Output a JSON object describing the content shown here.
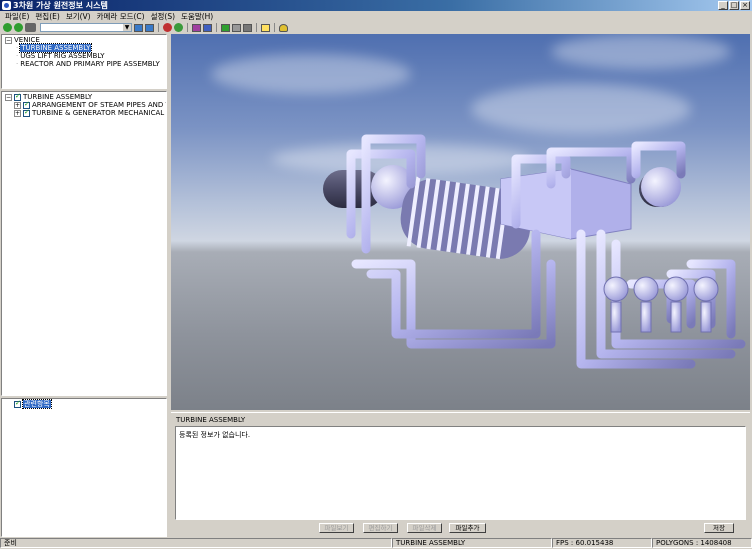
{
  "window": {
    "title": "3차원 가상 원전정보 시스템"
  },
  "menu": [
    "파일(E)",
    "편집(E)",
    "보기(V)",
    "카메라 모드(C)",
    "설정(S)",
    "도움말(H)"
  ],
  "tree_top": {
    "root": "VENICE",
    "children": [
      "TURBINE ASSEMBLY",
      "UGS LIFT RIG ASSEMBLY",
      "REACTOR AND PRIMARY PIPE ASSEMBLY"
    ]
  },
  "tree_mid": {
    "root": "TURBINE ASSEMBLY",
    "children": [
      "ARRANGEMENT OF STEAM PIPES AND VALVES",
      "TURBINE & GENERATOR MECHANICAL OUTLINE"
    ]
  },
  "tree_bottom": {
    "item": "관련항목"
  },
  "info": {
    "title": "TURBINE ASSEMBLY",
    "text": "등록된 정보가 없습니다.",
    "buttons": {
      "view": "파일보기",
      "edit": "편집하기",
      "delete": "파일삭제",
      "add": "파일추가"
    },
    "save": "저장"
  },
  "status": {
    "ready": "준비",
    "selected": "TURBINE ASSEMBLY",
    "fps": "FPS : 60.015438",
    "polygons": "POLYGONS : 1408408"
  },
  "colors": {
    "title_bar": "#0a246a",
    "selection": "#316ac5",
    "model": "#b8b8f0"
  }
}
